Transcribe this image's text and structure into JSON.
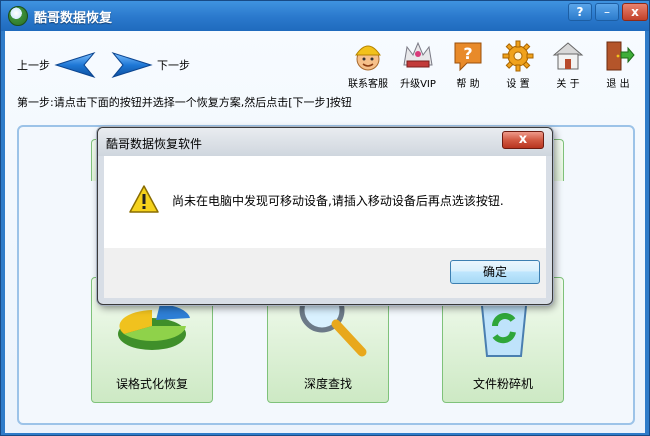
{
  "window": {
    "title": "酷哥数据恢复",
    "help_label": "?",
    "minimize_label": "–",
    "close_label": "x"
  },
  "nav": {
    "prev_label": "上一步",
    "next_label": "下一步"
  },
  "toolbar": {
    "items": [
      {
        "label": "联系客服",
        "icon": "support-person-icon"
      },
      {
        "label": "升级VIP",
        "icon": "vip-crown-icon"
      },
      {
        "label": "帮 助",
        "icon": "help-question-icon"
      },
      {
        "label": "设 置",
        "icon": "gear-icon"
      },
      {
        "label": "关 于",
        "icon": "home-icon"
      },
      {
        "label": "退 出",
        "icon": "exit-door-icon"
      }
    ]
  },
  "instruction": "第一步:请点击下面的按钮并选择一个恢复方案,然后点击[下一步]按钮",
  "options": [
    {
      "label": "误格式化恢复",
      "icon": "pie-chart-icon"
    },
    {
      "label": "深度查找",
      "icon": "magnifier-icon"
    },
    {
      "label": "文件粉碎机",
      "icon": "recycle-bin-icon"
    }
  ],
  "dialog": {
    "title": "酷哥数据恢复软件",
    "close_label": "x",
    "message": "尚未在电脑中发现可移动设备,请插入移动设备后再点选该按钮.",
    "ok_label": "确定"
  },
  "colors": {
    "title_bar": "#2a78cc",
    "arrow_blue": "#1f78d6",
    "card_green": "#7fc27a",
    "dialog_close": "#c1412a"
  }
}
